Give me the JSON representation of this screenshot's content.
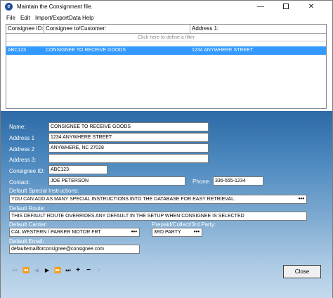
{
  "window": {
    "title": "Maintain the Consignment file.",
    "minimize": "—",
    "close": "✕"
  },
  "menu": [
    "File",
    "Edit",
    "Import/ExportData",
    "Help"
  ],
  "grid": {
    "columns": [
      "Consignee ID:",
      "Consignee to/Customer:",
      "Address 1:"
    ],
    "filter_text": "Click here to define a filter",
    "rows": [
      [
        "ABC123",
        "CONSIGNEE TO RECEIVE GOODS",
        "1234 ANYWHERE STREET"
      ]
    ]
  },
  "form": {
    "name_label": "Name:",
    "name_value": "CONSIGNEE TO RECEIVE GOODS",
    "address1_label": "Address 1",
    "address1_value": "1234 ANYWHERE STREET",
    "address2_label": "Address 2",
    "address2_value": "ANYWHERE, NC 27028",
    "address3_label": "Address 3:",
    "address3_value": "",
    "consignee_id_label": "Consignee ID:",
    "consignee_id_value": "ABC123",
    "contact_label": "Contact:",
    "contact_value": "JOE PETERSON",
    "phone_label": "Phone:",
    "phone_value": "336-555-1234",
    "special_instructions_label": "Default Special Instructions:",
    "special_instructions_value": "YOU CAN ADD AS MANY SPECIAL INSTRUCTIONS INTO THE DATABASE FOR EASY RETRIEVAL.",
    "route_label": "Default Route:",
    "route_value": "THIS DEFAULT ROUTE OVERRIDES ANY DEFAULT IN THE SETUP WHEN CONSIGNEE IS SELECTED",
    "carrier_label": "Default Carrier:",
    "carrier_value": "CAL WESTERN / PARKER MOTOR FRT",
    "prepaid_label": "Prepaid/Collect/3rd Party:",
    "prepaid_value": "3RD PARTY",
    "email_label": "Default Email:",
    "email_value": "defaultemailforconsignee@consignee.com",
    "ellipsis": "•••"
  },
  "navigator": {
    "first": "⏮",
    "prev_page": "⏪",
    "prev": "◀",
    "next": "▶",
    "next_page": "⏩",
    "last": "⏭",
    "add": "+",
    "delete": "−",
    "post": "✓"
  },
  "buttons": {
    "close": "Close"
  },
  "colors": {
    "selection": "#3399ff",
    "panel_top": "#2d6aa6",
    "panel_bottom": "#c4d9ec"
  }
}
